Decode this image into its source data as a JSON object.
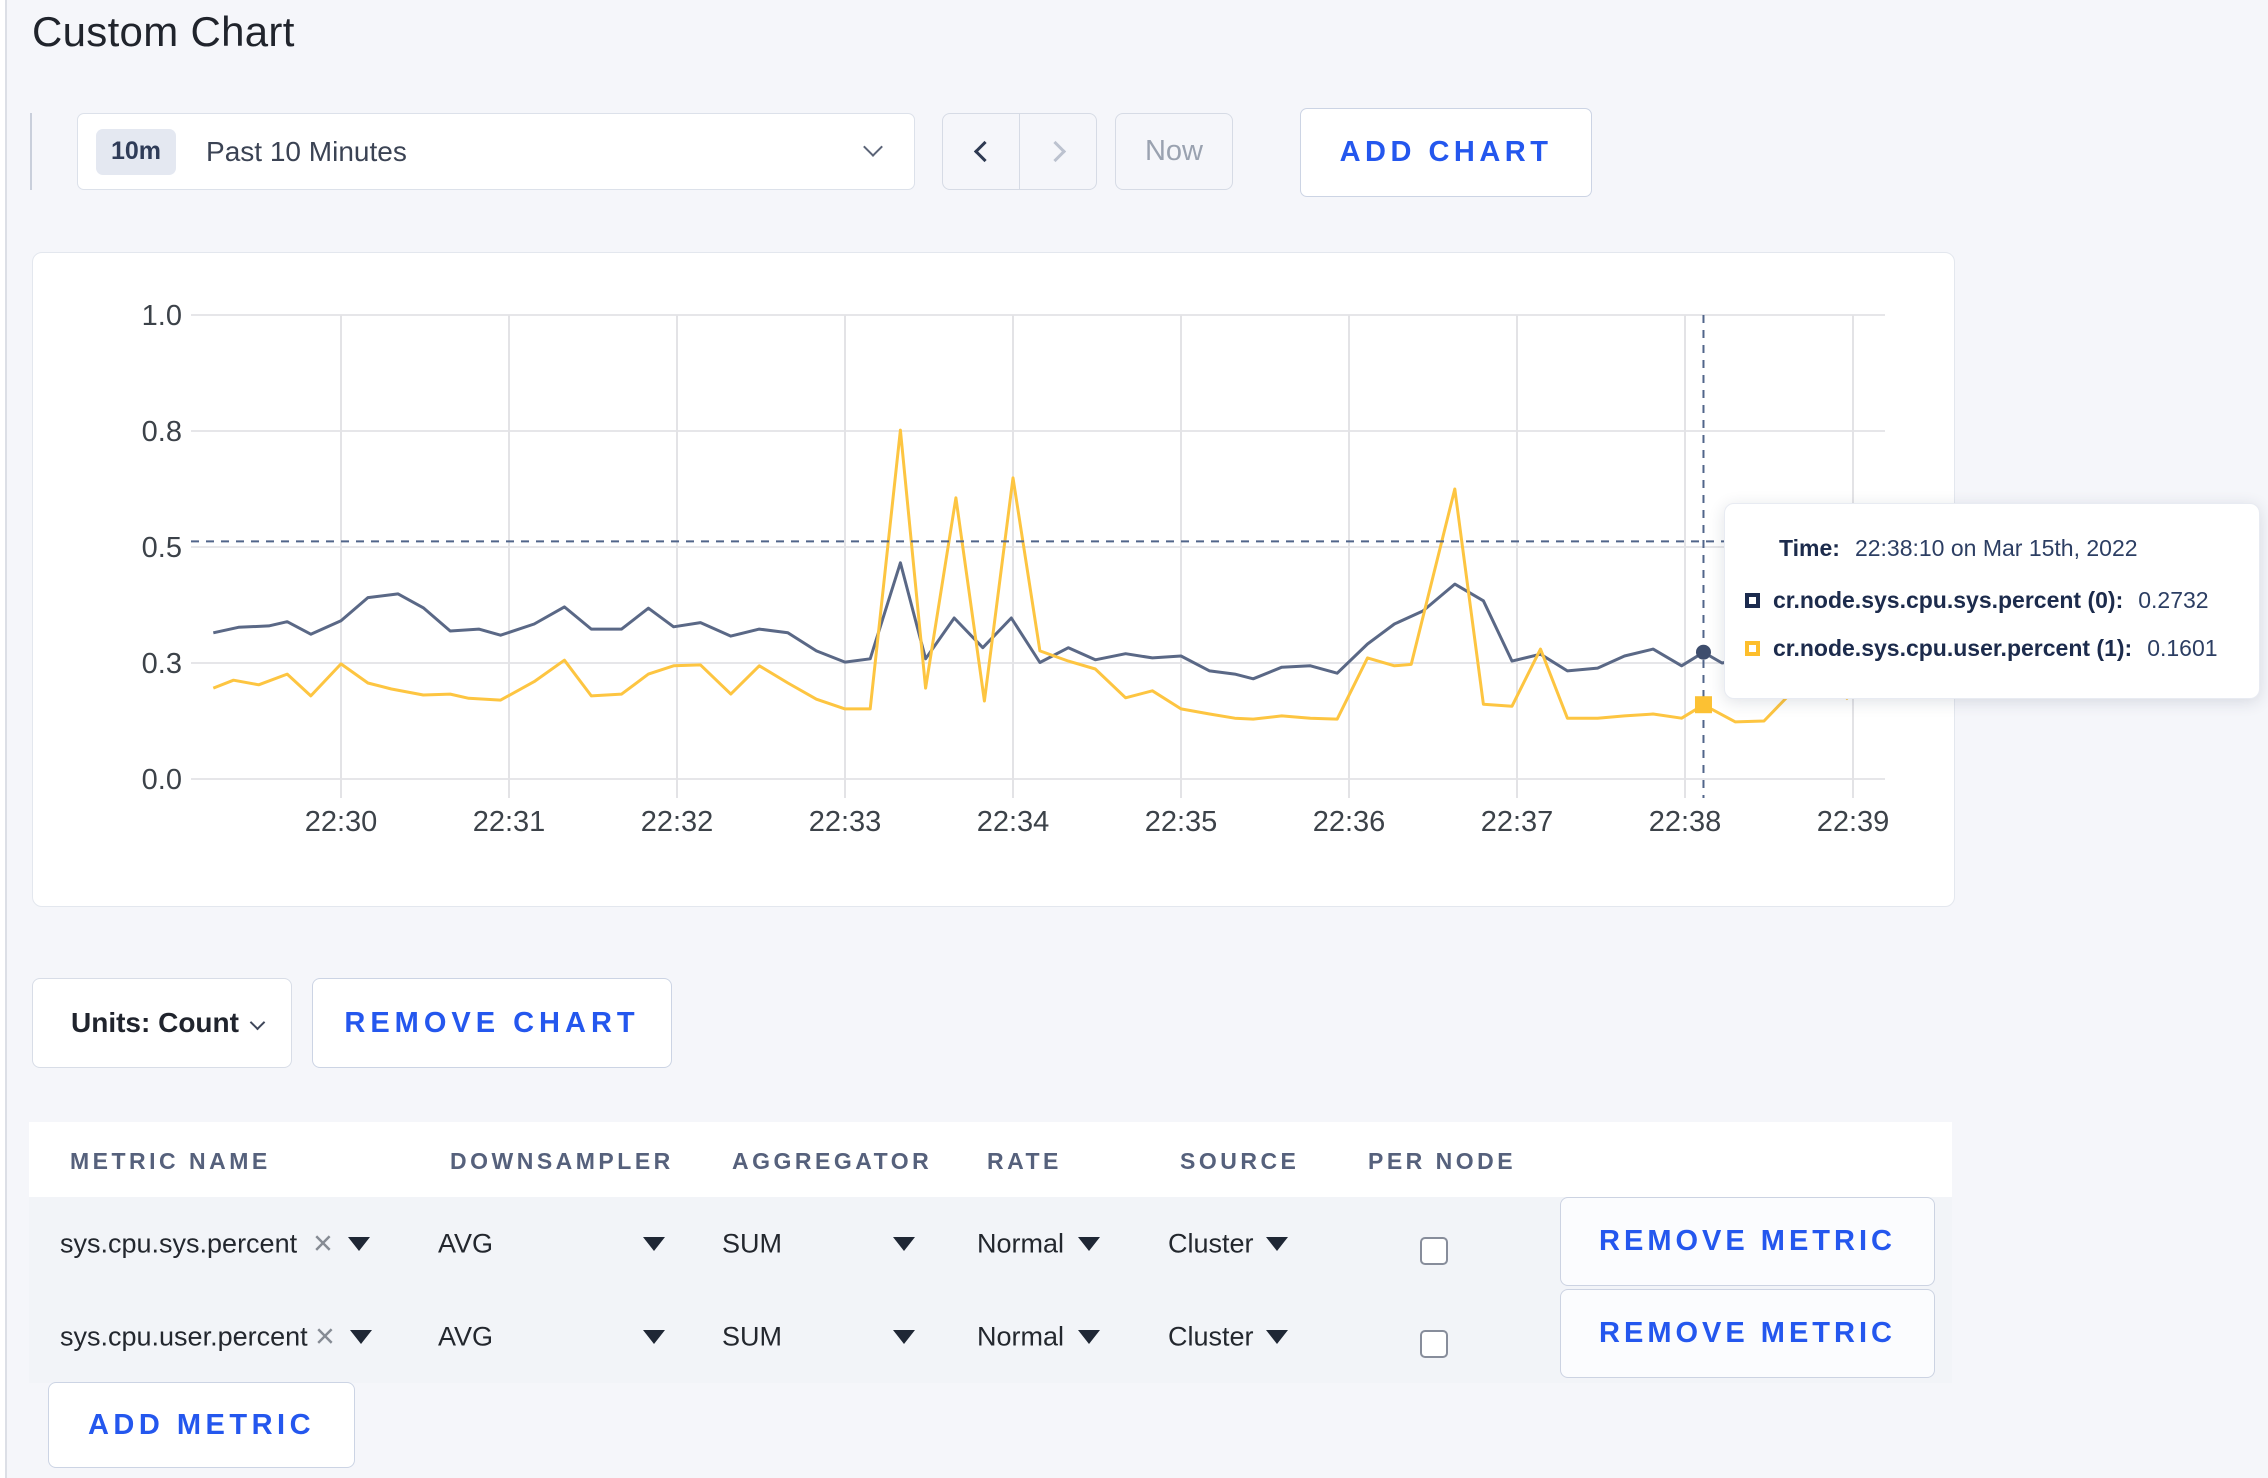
{
  "page": {
    "title": "Custom Chart"
  },
  "toolbar": {
    "time_range_badge": "10m",
    "time_range_label": "Past 10 Minutes",
    "now_label": "Now",
    "add_chart_label": "ADD CHART"
  },
  "chart_data": {
    "type": "line",
    "title": "",
    "xlabel": "",
    "ylabel": "",
    "ylim": [
      0,
      1
    ],
    "grid": true,
    "yticks": [
      {
        "v": 0.0,
        "label": "0.0"
      },
      {
        "v": 0.25,
        "label": "0.3"
      },
      {
        "v": 0.5,
        "label": "0.5"
      },
      {
        "v": 0.75,
        "label": "0.8"
      },
      {
        "v": 1.0,
        "label": "1.0"
      }
    ],
    "xticks": [
      {
        "t": 0,
        "label": "22:30"
      },
      {
        "t": 1,
        "label": "22:31"
      },
      {
        "t": 2,
        "label": "22:32"
      },
      {
        "t": 3,
        "label": "22:33"
      },
      {
        "t": 4,
        "label": "22:34"
      },
      {
        "t": 5,
        "label": "22:35"
      },
      {
        "t": 6,
        "label": "22:36"
      },
      {
        "t": 7,
        "label": "22:37"
      },
      {
        "t": 8,
        "label": "22:38"
      },
      {
        "t": 9,
        "label": "22:39"
      }
    ],
    "series": [
      {
        "name": "cr.node.sys.cpu.sys.percent (0)",
        "color": "#5a6886",
        "points": [
          [
            -0.76,
            0.315
          ],
          [
            -0.61,
            0.327
          ],
          [
            -0.43,
            0.33
          ],
          [
            -0.32,
            0.339
          ],
          [
            -0.18,
            0.312
          ],
          [
            0.0,
            0.341
          ],
          [
            0.16,
            0.391
          ],
          [
            0.34,
            0.399
          ],
          [
            0.49,
            0.369
          ],
          [
            0.65,
            0.319
          ],
          [
            0.82,
            0.323
          ],
          [
            0.95,
            0.31
          ],
          [
            1.15,
            0.334
          ],
          [
            1.33,
            0.371
          ],
          [
            1.49,
            0.323
          ],
          [
            1.67,
            0.323
          ],
          [
            1.83,
            0.368
          ],
          [
            1.98,
            0.328
          ],
          [
            2.14,
            0.337
          ],
          [
            2.32,
            0.308
          ],
          [
            2.49,
            0.323
          ],
          [
            2.66,
            0.315
          ],
          [
            2.83,
            0.276
          ],
          [
            3.0,
            0.252
          ],
          [
            3.15,
            0.259
          ],
          [
            3.33,
            0.466
          ],
          [
            3.48,
            0.259
          ],
          [
            3.65,
            0.347
          ],
          [
            3.82,
            0.283
          ],
          [
            3.99,
            0.347
          ],
          [
            4.16,
            0.251
          ],
          [
            4.33,
            0.283
          ],
          [
            4.49,
            0.257
          ],
          [
            4.67,
            0.27
          ],
          [
            4.83,
            0.261
          ],
          [
            5.0,
            0.265
          ],
          [
            5.17,
            0.233
          ],
          [
            5.32,
            0.226
          ],
          [
            5.43,
            0.216
          ],
          [
            5.6,
            0.241
          ],
          [
            5.77,
            0.244
          ],
          [
            5.93,
            0.228
          ],
          [
            6.11,
            0.291
          ],
          [
            6.27,
            0.334
          ],
          [
            6.44,
            0.362
          ],
          [
            6.63,
            0.42
          ],
          [
            6.8,
            0.384
          ],
          [
            6.97,
            0.254
          ],
          [
            7.14,
            0.269
          ],
          [
            7.3,
            0.233
          ],
          [
            7.48,
            0.239
          ],
          [
            7.64,
            0.265
          ],
          [
            7.81,
            0.28
          ],
          [
            7.98,
            0.244
          ],
          [
            8.11,
            0.273
          ],
          [
            8.22,
            0.25
          ],
          [
            8.4,
            0.262
          ],
          [
            8.57,
            0.268
          ],
          [
            8.73,
            0.256
          ],
          [
            8.9,
            0.262
          ],
          [
            9.0,
            0.268
          ]
        ]
      },
      {
        "name": "cr.node.sys.cpu.user.percent (1)",
        "color": "#fdc541",
        "points": [
          [
            -0.76,
            0.196
          ],
          [
            -0.64,
            0.213
          ],
          [
            -0.49,
            0.203
          ],
          [
            -0.32,
            0.226
          ],
          [
            -0.18,
            0.179
          ],
          [
            0.0,
            0.248
          ],
          [
            0.16,
            0.207
          ],
          [
            0.3,
            0.194
          ],
          [
            0.49,
            0.181
          ],
          [
            0.65,
            0.183
          ],
          [
            0.76,
            0.174
          ],
          [
            0.95,
            0.17
          ],
          [
            1.15,
            0.21
          ],
          [
            1.33,
            0.256
          ],
          [
            1.49,
            0.179
          ],
          [
            1.67,
            0.183
          ],
          [
            1.83,
            0.226
          ],
          [
            1.98,
            0.244
          ],
          [
            2.14,
            0.246
          ],
          [
            2.32,
            0.183
          ],
          [
            2.49,
            0.244
          ],
          [
            2.66,
            0.207
          ],
          [
            2.83,
            0.172
          ],
          [
            3.0,
            0.151
          ],
          [
            3.15,
            0.151
          ],
          [
            3.33,
            0.752
          ],
          [
            3.48,
            0.196
          ],
          [
            3.66,
            0.606
          ],
          [
            3.83,
            0.168
          ],
          [
            4.0,
            0.649
          ],
          [
            4.16,
            0.276
          ],
          [
            4.33,
            0.254
          ],
          [
            4.49,
            0.237
          ],
          [
            4.67,
            0.175
          ],
          [
            4.83,
            0.19
          ],
          [
            5.0,
            0.151
          ],
          [
            5.17,
            0.14
          ],
          [
            5.32,
            0.131
          ],
          [
            5.43,
            0.129
          ],
          [
            5.6,
            0.136
          ],
          [
            5.77,
            0.131
          ],
          [
            5.93,
            0.129
          ],
          [
            6.11,
            0.261
          ],
          [
            6.27,
            0.244
          ],
          [
            6.37,
            0.247
          ],
          [
            6.63,
            0.625
          ],
          [
            6.8,
            0.161
          ],
          [
            6.97,
            0.157
          ],
          [
            7.14,
            0.28
          ],
          [
            7.3,
            0.131
          ],
          [
            7.48,
            0.131
          ],
          [
            7.64,
            0.136
          ],
          [
            7.81,
            0.14
          ],
          [
            7.98,
            0.131
          ],
          [
            8.11,
            0.16
          ],
          [
            8.3,
            0.123
          ],
          [
            8.47,
            0.125
          ],
          [
            8.67,
            0.2
          ],
          [
            8.81,
            0.225
          ],
          [
            8.97,
            0.172
          ]
        ]
      }
    ],
    "crosshair": {
      "t": 8.11,
      "y_value": 0.512,
      "highlights": [
        {
          "series": 0,
          "value": 0.2732
        },
        {
          "series": 1,
          "value": 0.1601
        }
      ]
    }
  },
  "tooltip": {
    "time_label": "Time:",
    "time_value": "22:38:10 on Mar 15th, 2022",
    "entries": [
      {
        "label": "cr.node.sys.cpu.sys.percent (0):",
        "value": "0.2732",
        "color": "#1b2b4e"
      },
      {
        "label": "cr.node.sys.cpu.user.percent (1):",
        "value": "0.1601",
        "color": "#fdbe2c"
      }
    ]
  },
  "chart_footer": {
    "units_label": "Units: Count",
    "remove_chart_label": "REMOVE CHART"
  },
  "metrics_table": {
    "headers": [
      "METRIC NAME",
      "DOWNSAMPLER",
      "AGGREGATOR",
      "RATE",
      "SOURCE",
      "PER NODE"
    ],
    "rows": [
      {
        "metric_name": "sys.cpu.sys.percent",
        "downsampler": "AVG",
        "aggregator": "SUM",
        "rate": "Normal",
        "source": "Cluster",
        "per_node_checked": false,
        "remove_label": "REMOVE METRIC"
      },
      {
        "metric_name": "sys.cpu.user.percent",
        "downsampler": "AVG",
        "aggregator": "SUM",
        "rate": "Normal",
        "source": "Cluster",
        "per_node_checked": false,
        "remove_label": "REMOVE METRIC"
      }
    ],
    "add_metric_label": "ADD METRIC"
  }
}
